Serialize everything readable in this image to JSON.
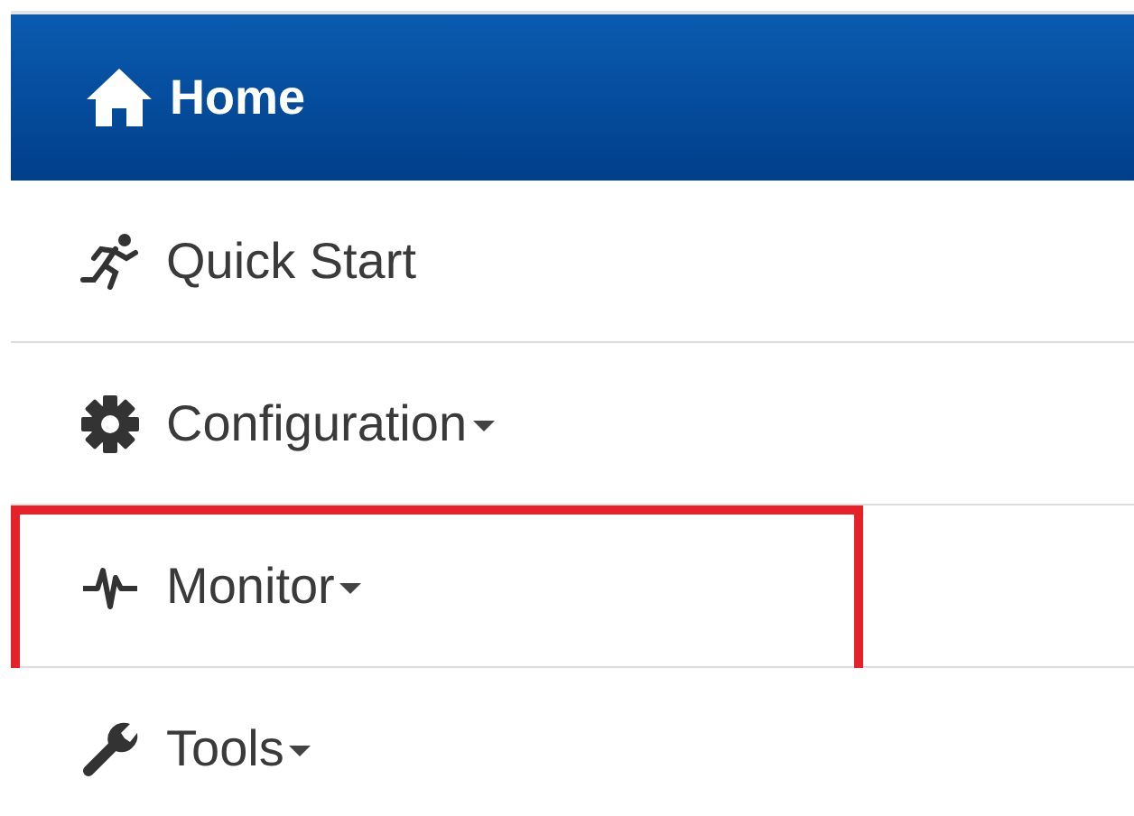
{
  "header": {
    "label": "Home"
  },
  "items": [
    {
      "label": "Quick Start",
      "dropdown": false,
      "highlighted": false
    },
    {
      "label": "Configuration",
      "dropdown": true,
      "highlighted": false
    },
    {
      "label": "Monitor",
      "dropdown": true,
      "highlighted": true
    },
    {
      "label": "Tools",
      "dropdown": true,
      "highlighted": false
    }
  ]
}
